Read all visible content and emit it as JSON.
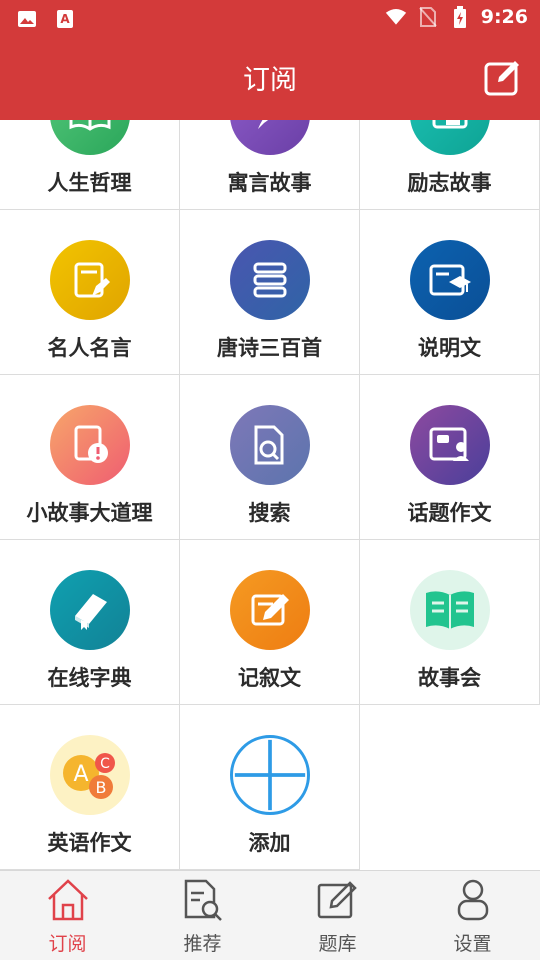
{
  "status_bar": {
    "time": "9:26",
    "colors": {
      "bar": "#d33a3a"
    }
  },
  "header": {
    "title": "订阅",
    "edit_icon": "edit-icon"
  },
  "grid": {
    "rows": [
      [
        {
          "label": "人生哲理",
          "icon": "book-icon",
          "color": "#3bb86a"
        },
        {
          "label": "寓言故事",
          "icon": "feather-icon",
          "color": "#7b4fb8"
        },
        {
          "label": "励志故事",
          "icon": "thumbs-up-icon",
          "color": "#13b3a6"
        }
      ],
      [
        {
          "label": "名人名言",
          "icon": "pen-note-icon",
          "color": "#e6b300"
        },
        {
          "label": "唐诗三百首",
          "icon": "stack-icon",
          "color": "#3f4fa8"
        },
        {
          "label": "说明文",
          "icon": "graduation-card-icon",
          "color": "#0b5ea8"
        }
      ],
      [
        {
          "label": "小故事大道理",
          "icon": "alert-note-icon",
          "color": "#f07a6a"
        },
        {
          "label": "搜索",
          "icon": "search-doc-icon",
          "color": "#6d77b3"
        },
        {
          "label": "话题作文",
          "icon": "chat-person-icon",
          "color": "#7a4a9a"
        }
      ],
      [
        {
          "label": "在线字典",
          "icon": "dictionary-icon",
          "color": "#138fa0"
        },
        {
          "label": "记叙文",
          "icon": "pencil-note-icon",
          "color": "#f28a1c"
        },
        {
          "label": "故事会",
          "icon": "open-book-icon",
          "color": "#22c48f"
        }
      ],
      [
        {
          "label": "英语作文",
          "icon": "abc-icon",
          "color": "#f5b52e"
        },
        {
          "label": "添加",
          "icon": "plus-icon",
          "color": "#2e9be6"
        }
      ]
    ]
  },
  "bottom_nav": {
    "items": [
      {
        "label": "订阅",
        "icon": "home-icon",
        "active": true
      },
      {
        "label": "推荐",
        "icon": "search-doc-icon",
        "active": false
      },
      {
        "label": "题库",
        "icon": "edit-icon",
        "active": false
      },
      {
        "label": "设置",
        "icon": "user-icon",
        "active": false
      }
    ],
    "colors": {
      "active": "#e0424a",
      "inactive": "#555555"
    }
  }
}
